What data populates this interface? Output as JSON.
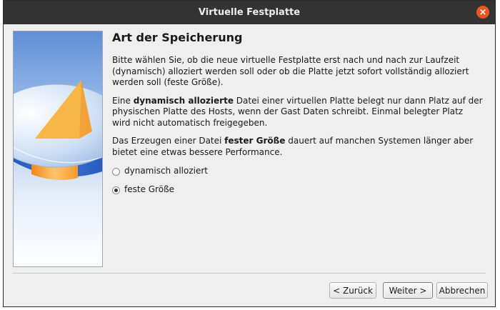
{
  "window": {
    "title": "Virtuelle Festplatte",
    "close_glyph": "×"
  },
  "page": {
    "title": "Art der Speicherung",
    "para1": "Bitte wählen Sie, ob die neue virtuelle Festplatte erst nach und nach zur Laufzeit (dynamisch) alloziert werden soll oder ob die Platte jetzt sofort vollständig alloziert werden soll (feste Größe).",
    "para2": {
      "pre": "Eine ",
      "bold": "dynamisch allozierte",
      "post": " Datei einer virtuellen Platte belegt nur dann Platz auf der physischen Platte des Hosts, wenn der Gast Daten schreibt. Einmal belegter Platz wird nicht automatisch freigegeben."
    },
    "para3": {
      "pre": "Das Erzeugen einer Datei ",
      "bold": "fester Größe",
      "post": " dauert auf manchen Systemen länger aber bietet eine etwas bessere Performance."
    },
    "options": [
      {
        "label": "dynamisch alloziert",
        "selected": false
      },
      {
        "label": "feste Größe",
        "selected": true
      }
    ]
  },
  "buttons": {
    "back": "< Zurück",
    "next": "Weiter >",
    "cancel": "Abbrechen"
  },
  "colors": {
    "titlebar": "#333333",
    "close_button": "#e95420",
    "art_blue": "#2f63c9",
    "art_orange": "#f6a53a"
  }
}
